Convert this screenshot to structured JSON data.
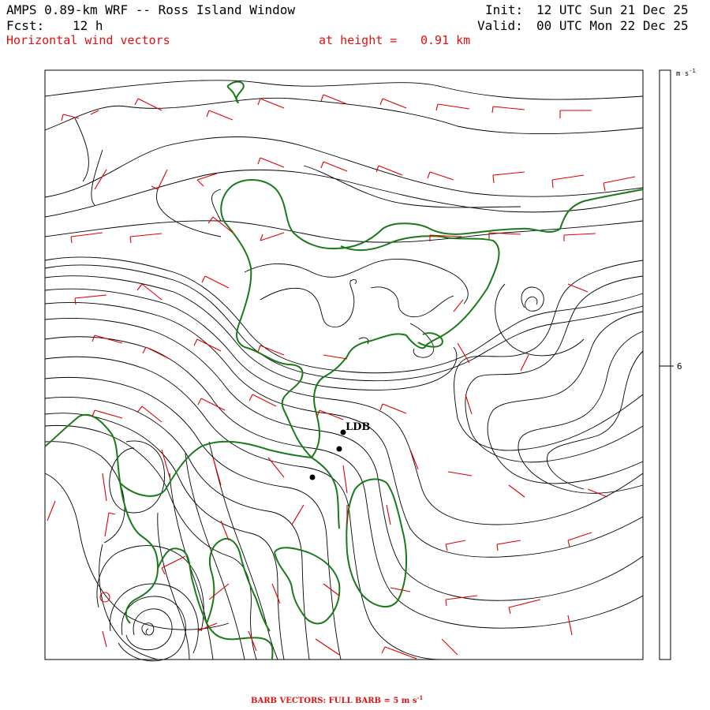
{
  "header": {
    "title": "AMPS 0.89-km WRF -- Ross Island Window",
    "fcst_label": "Fcst:",
    "fcst_value": "12 h",
    "field": "Horizontal wind vectors",
    "height_label": "at height =",
    "height_value": "0.91 km",
    "init_label": "Init:",
    "init_value": "12 UTC Sun 21 Dec 25",
    "valid_label": "Valid:",
    "valid_value": "00 UTC Mon 22 Dec 25"
  },
  "colorbar": {
    "unit": "m s",
    "unit_exp": "-1",
    "tick_label": "6"
  },
  "map": {
    "station_label": "LDB",
    "stations": [
      "LDB"
    ]
  },
  "footer": {
    "note_main": "BARB VECTORS:  FULL BARB = 5 m s",
    "note_exp": "-1"
  },
  "colors": {
    "barbs": "#e00000",
    "coastline": "#1a7a1a",
    "streamlines": "#000000",
    "labels_red": "#e01010"
  }
}
